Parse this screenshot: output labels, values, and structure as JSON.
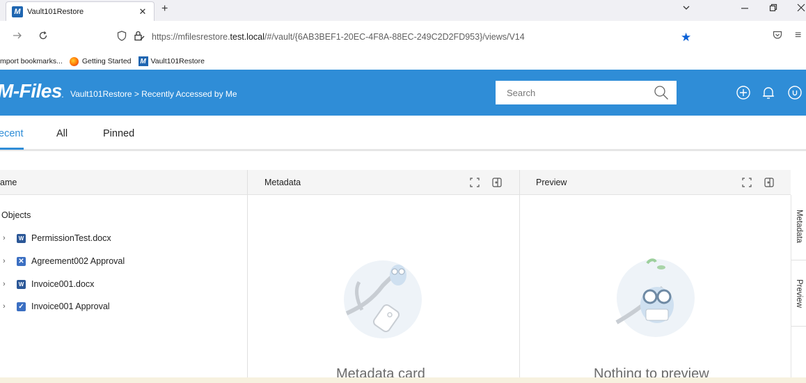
{
  "browser": {
    "tab_title": "Vault101Restore",
    "tab_favicon": "M",
    "url_plain": "https://mfilesrestore.",
    "url_host": "test.local",
    "url_rest": "/#/vault/{6AB3BEF1-20EC-4F8A-88EC-249C2D2FD953}/views/V14",
    "bookmarks": [
      {
        "label": "mport bookmarks...",
        "icon": "none"
      },
      {
        "label": "Getting Started",
        "icon": "firefox-icon"
      },
      {
        "label": "Vault101Restore",
        "icon": "m-files-icon"
      }
    ]
  },
  "app": {
    "logo": "M-Files",
    "breadcrumb": "Vault101Restore > Recently Accessed by Me",
    "search_placeholder": "Search",
    "brand_color": "#2f8dd7"
  },
  "tabs": [
    {
      "label": "ecent",
      "active": true
    },
    {
      "label": "All",
      "active": false
    },
    {
      "label": "Pinned",
      "active": false
    }
  ],
  "list": {
    "header": "ame",
    "group": "Objects",
    "items": [
      {
        "label": "PermissionTest.docx",
        "icon": "word-doc-icon"
      },
      {
        "label": "Agreement002 Approval",
        "icon": "assignment-icon"
      },
      {
        "label": "Invoice001.docx",
        "icon": "word-doc-icon"
      },
      {
        "label": "Invoice001 Approval",
        "icon": "assignment-complete-icon"
      }
    ]
  },
  "metadata_panel": {
    "header": "Metadata",
    "empty_text": "Metadata card"
  },
  "preview_panel": {
    "header": "Preview",
    "empty_text": "Nothing to preview"
  },
  "side_tabs": [
    "Metadata",
    "Preview"
  ]
}
